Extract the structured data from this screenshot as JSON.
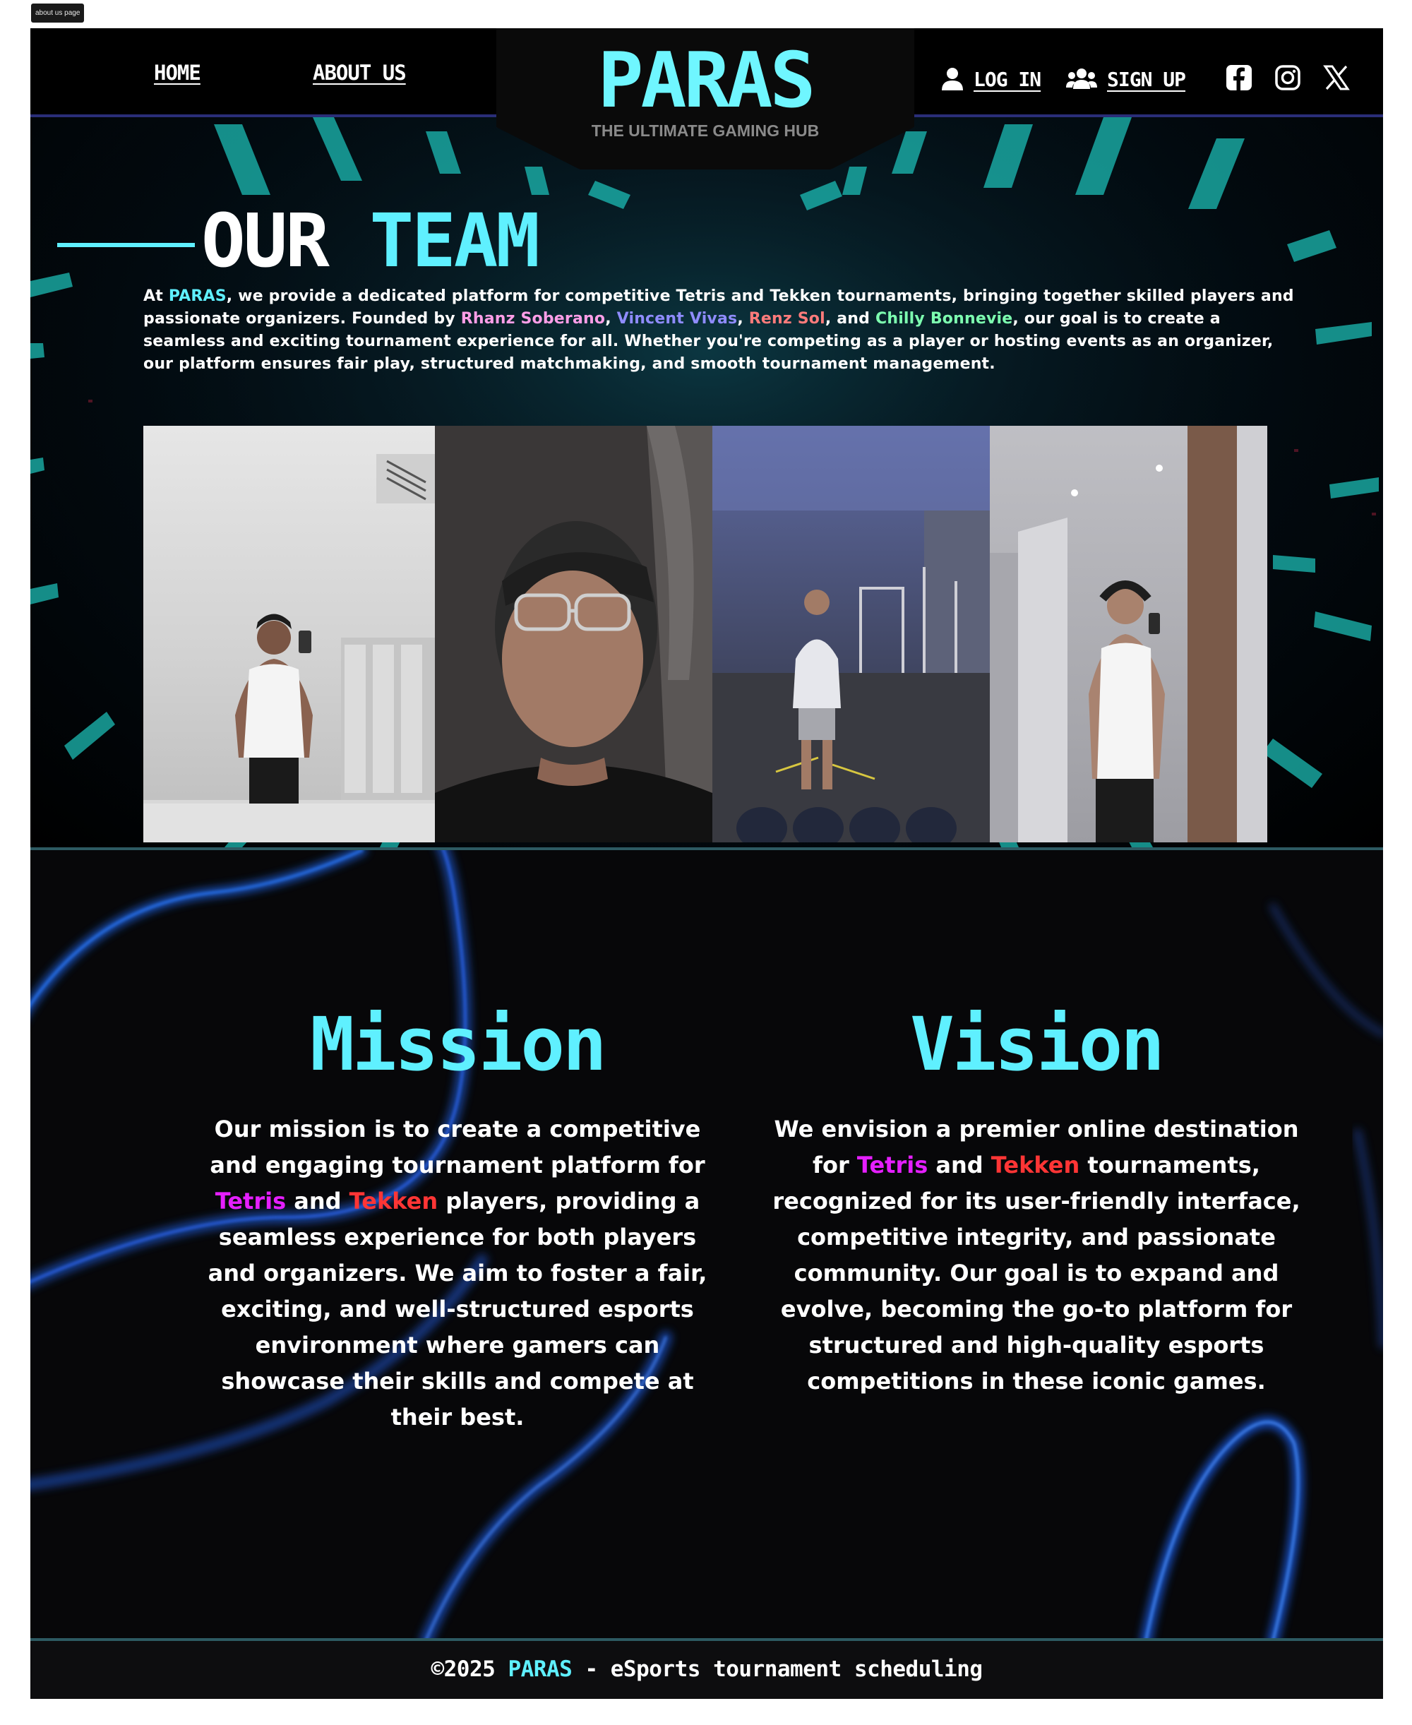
{
  "page_tag": "about us page",
  "nav": {
    "home": "HOME",
    "about": "ABOUT US",
    "login": "LOG IN",
    "signup": "SIGN UP",
    "social": [
      "facebook-icon",
      "instagram-icon",
      "x-icon"
    ]
  },
  "brand": {
    "logo": "PARAS",
    "tagline": "THE ULTIMATE GAMING HUB",
    "accent": "#5ff0ff"
  },
  "team": {
    "title_white": "OUR",
    "title_cyan": "TEAM",
    "intro_1": "At ",
    "intro_brand": "PARAS",
    "intro_2": ", we provide a dedicated platform for competitive Tetris and Tekken tournaments, bringing together skilled players and passionate organizers. Founded by ",
    "founder_1": "Rhanz Soberano",
    "sep_1": ", ",
    "founder_2": "Vincent Vivas",
    "sep_2": ", ",
    "founder_3": "Renz Sol",
    "sep_3": ", and ",
    "founder_4": "Chilly Bonnevie",
    "intro_3": ", our goal is to create a seamless and exciting tournament experience for all. Whether you're competing as a player or hosting events as an organizer, our platform ensures fair play, structured matchmaking, and smooth tournament management."
  },
  "mission": {
    "heading": "Mission",
    "p1": "Our mission is to create a competitive and engaging tournament platform for ",
    "tetris": "Tetris",
    "and": " and ",
    "tekken": "Tekken",
    "p2": " players, providing a seamless experience for both players and organizers. We aim to foster a fair, exciting, and well-structured esports environment where gamers can showcase their skills and compete at their best."
  },
  "vision": {
    "heading": "Vision",
    "p1": "We envision a premier online destination for ",
    "tetris": "Tetris",
    "and": " and ",
    "tekken": "Tekken",
    "p2": " tournaments, recognized for its user-friendly interface, competitive integrity, and passionate community. Our goal is to expand and evolve, becoming the go-to platform for structured and high-quality esports competitions in these iconic games."
  },
  "footer": {
    "prefix": "©2025 ",
    "brand": "PARAS",
    "suffix": " - eSports tournament scheduling"
  }
}
